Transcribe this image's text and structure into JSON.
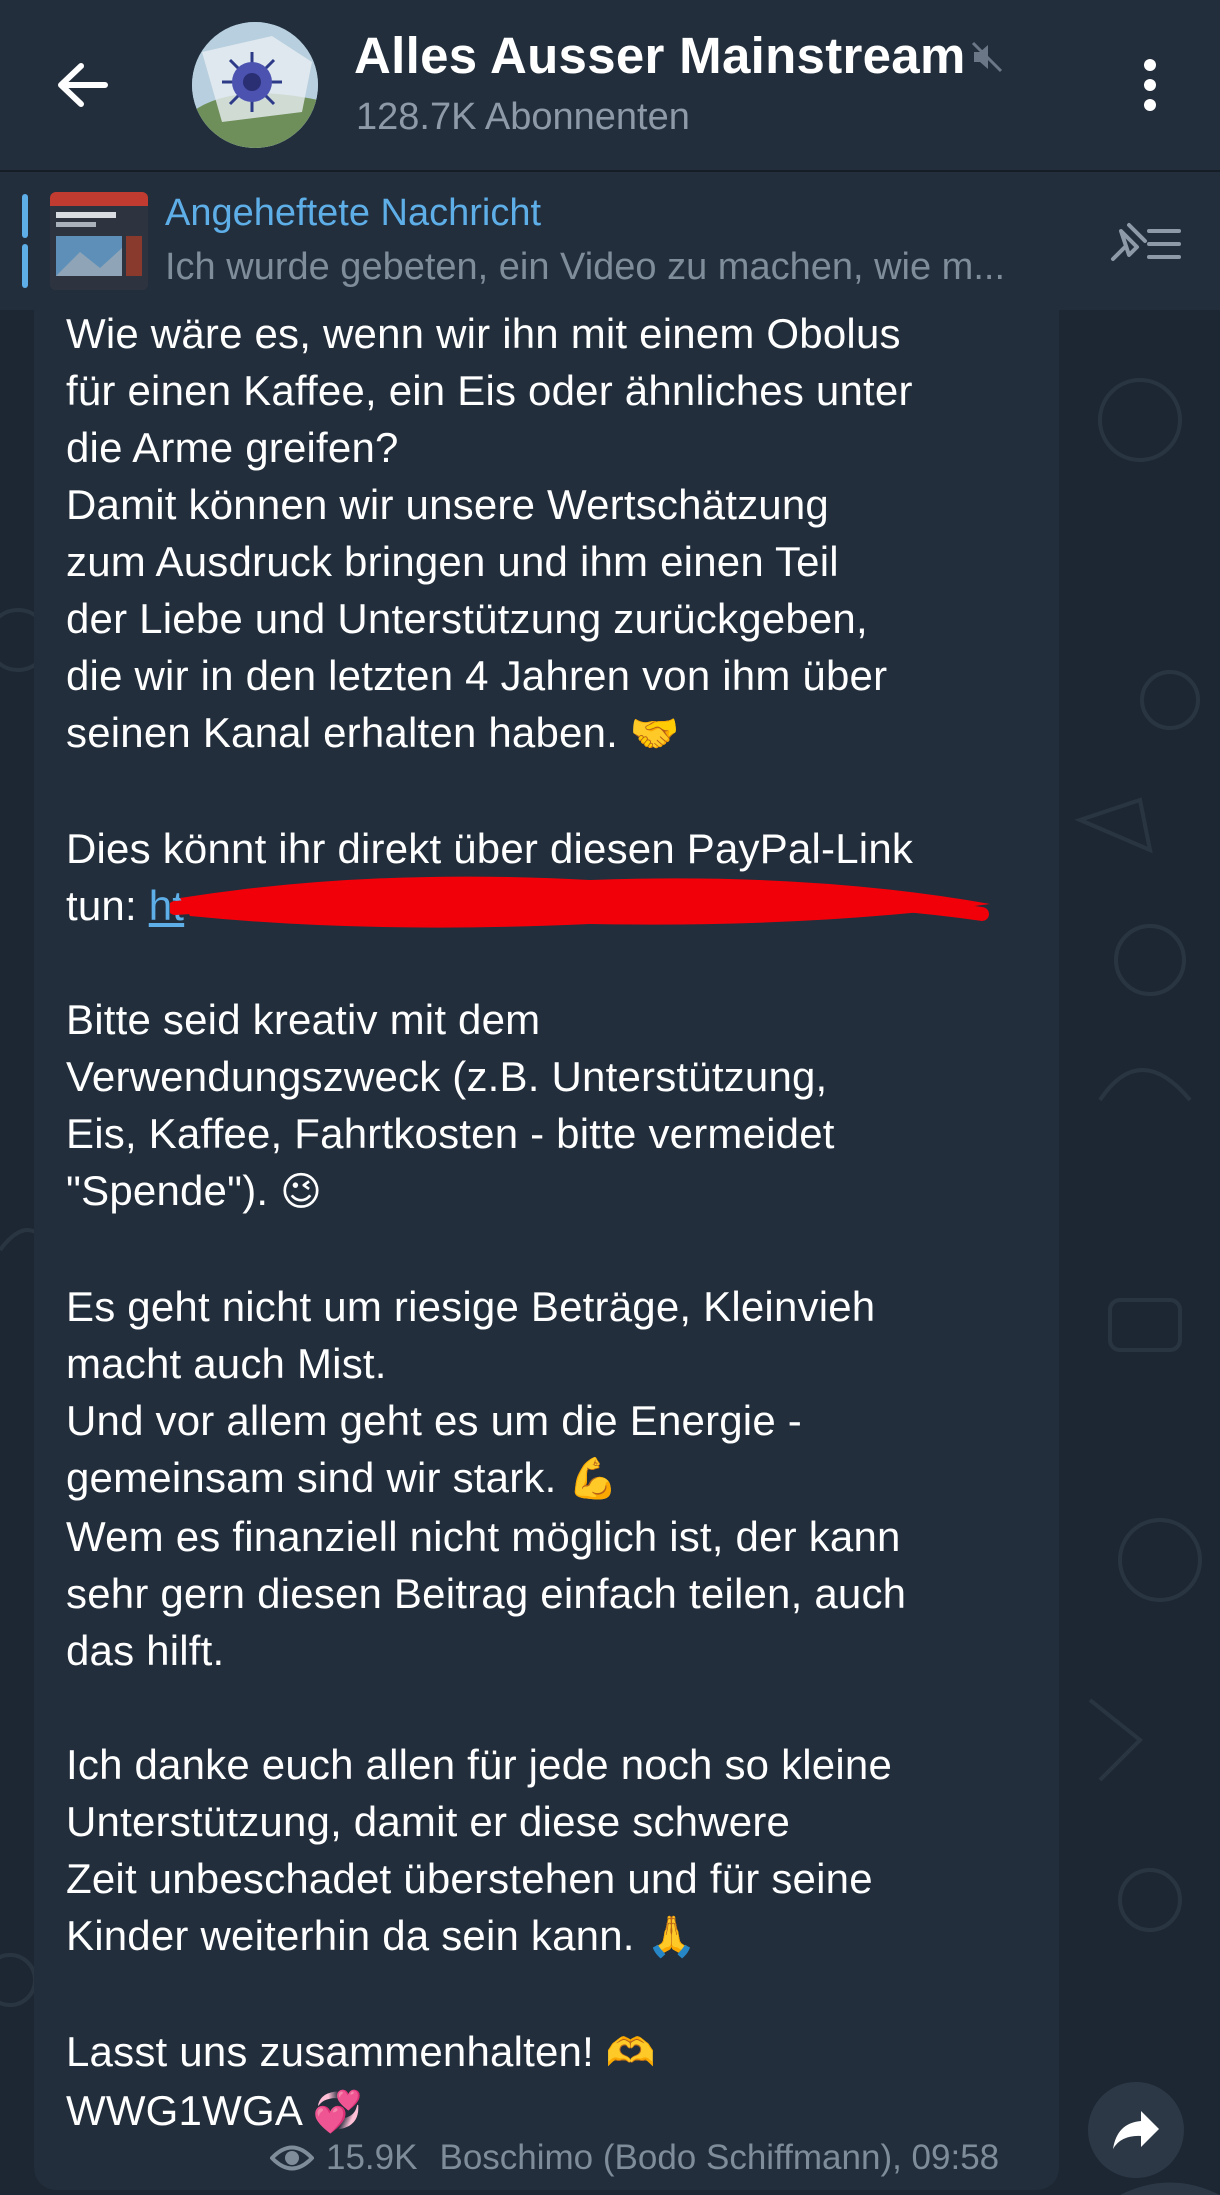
{
  "header": {
    "title": "Alles Ausser Mainstream",
    "subscribers": "128.7K Abonnenten"
  },
  "pinned": {
    "title": "Angeheftete Nachricht",
    "preview": "Ich wurde gebeten, ein Video zu machen, wie m..."
  },
  "message": {
    "paragraphs": [
      "Wie wäre es, wenn wir ihn mit einem Obolus\nfür einen Kaffee, ein Eis oder ähnliches unter\ndie Arme greifen?\nDamit können wir unsere Wertschätzung\nzum Ausdruck bringen und ihm einen Teil\nder Liebe und Unterstützung zurückgeben,\ndie wir in den letzten 4 Jahren von ihm über\nseinen Kanal erhalten haben.",
      "Dies könnt ihr direkt über diesen PayPal-Link",
      "Bitte seid kreativ mit dem\nVerwendungszweck (z.B. Unterstützung,\nEis, Kaffee, Fahrtkosten - bitte vermeidet\n\"Spende\").",
      "Es geht nicht um riesige Beträge, Kleinvieh\nmacht auch Mist.\nUnd vor allem geht es um die Energie -\ngemeinsam sind wir stark.",
      "Wem es finanziell nicht möglich ist, der kann\nsehr gern diesen Beitrag einfach teilen, auch\ndas hilft.",
      "Ich danke euch allen für jede noch so kleine\nUnterstützung, damit er diese schwere\nZeit unbeschadet überstehen und für seine\nKinder weiterhin da sein kann.",
      "Lasst uns zusammenhalten!",
      "WWG1WGA"
    ],
    "link_prefix": "tun:",
    "link_text": "ht",
    "emojis": {
      "handshake": "🤝",
      "wink": "😉",
      "muscle": "💪",
      "pray": "🙏",
      "heart_hands": "🫶",
      "hearts": "💞"
    }
  },
  "footer": {
    "views": "15.9K",
    "author_time": "Boschimo (Bodo Schiffmann), 09:58"
  },
  "colors": {
    "background": "#1d2733",
    "header": "#222e3c",
    "bubble": "#222e3c",
    "accent": "#5eaee8",
    "muted": "#7f8c99",
    "redaction": "#f2000a"
  }
}
